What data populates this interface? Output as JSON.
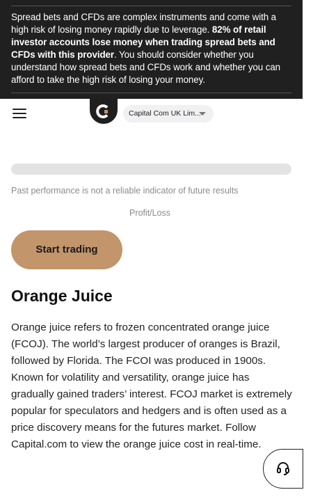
{
  "risk_warning": {
    "part1": "Spread bets and CFDs are complex instruments and come with a high risk of losing money rapidly due to leverage. ",
    "bold": "82% of retail investor accounts lose money when trading spread bets and CFDs with this provider",
    "part2": ". You should consider whether you understand how spread bets and CFDs work and whether you can afford to take the high risk of losing your money."
  },
  "header": {
    "menu_icon": "hamburger-icon",
    "logo_icon": "capital-com-logo",
    "entity_select": "Capital Com UK Lim..."
  },
  "calculator": {
    "progress": 0,
    "disclaimer": "Past performance is not a reliable indicator of future results",
    "profit_loss_label": "Profit/Loss"
  },
  "cta": {
    "start_trading": "Start trading"
  },
  "article": {
    "title": "Orange Juice",
    "body": "Orange juice refers to frozen concentrated orange juice (FCOJ). The world’s largest producer of oranges is Brazil, followed by Florida. The FCOI was produced in 1900s. Known for volatility and versatility, orange juice has gradually gained traders’ interest. FCOJ market is extremely popular for speculators and hedgers and is often used as a price discovery means for the futures market. Follow Capital.com to view the orange juice cost in real-time."
  },
  "support": {
    "icon": "headset-icon"
  },
  "colors": {
    "banner_bg": "#202020",
    "cta_bg": "#c2956a",
    "logo_accent": "#c2956a"
  }
}
